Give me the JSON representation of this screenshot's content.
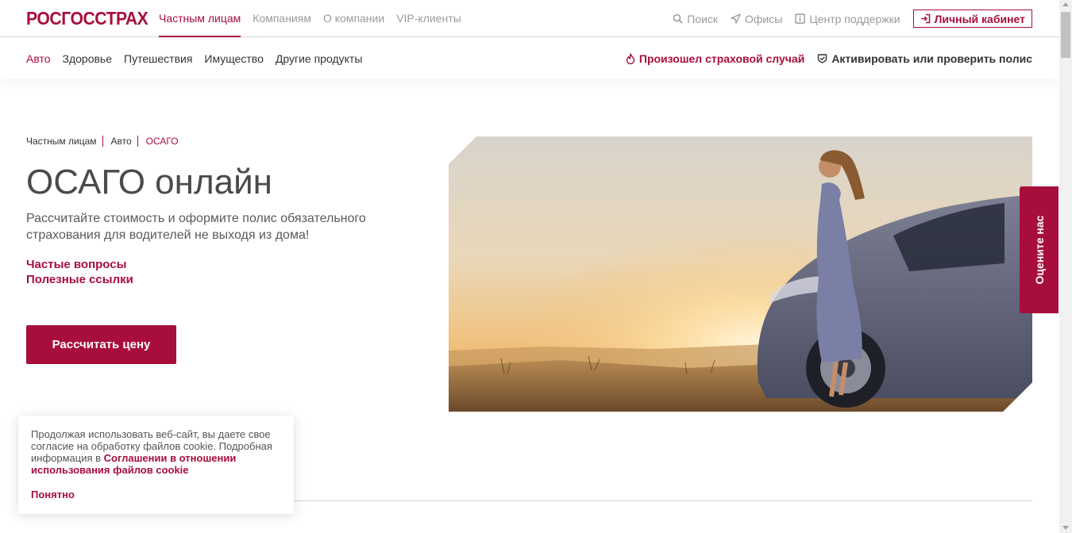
{
  "brand": {
    "logo": "РОСГОССТРАХ",
    "accent": "#a80e3c"
  },
  "main_nav": [
    "Частным лицам",
    "Компаниям",
    "О компании",
    "VIP-клиенты"
  ],
  "util_nav": {
    "search": "Поиск",
    "offices": "Офисы",
    "support": "Центр поддержки",
    "cabinet": "Личный кабинет"
  },
  "sub_nav": [
    "Авто",
    "Здоровье",
    "Путешествия",
    "Имущество",
    "Другие продукты"
  ],
  "sub_actions": {
    "insured_event": "Произошел страховой случай",
    "activate_policy": "Активировать или проверить полис"
  },
  "breadcrumb": [
    "Частным лицам",
    "Авто",
    "ОСАГО"
  ],
  "hero": {
    "title": "ОСАГО онлайн",
    "description": "Рассчитайте стоимость и оформите полис обязательного страхования для водителей не выходя из дома!",
    "links": [
      "Частые вопросы",
      "Полезные ссылки"
    ],
    "cta": "Рассчитать цену"
  },
  "rate_tab": "Оцените нас",
  "cookie": {
    "text": "Продолжая использовать веб-сайт, вы даете свое согласие на обработку файлов cookie. Подробная информация в ",
    "link": "Соглашении в отношении использования файлов cookie",
    "accept": "Понятно"
  }
}
